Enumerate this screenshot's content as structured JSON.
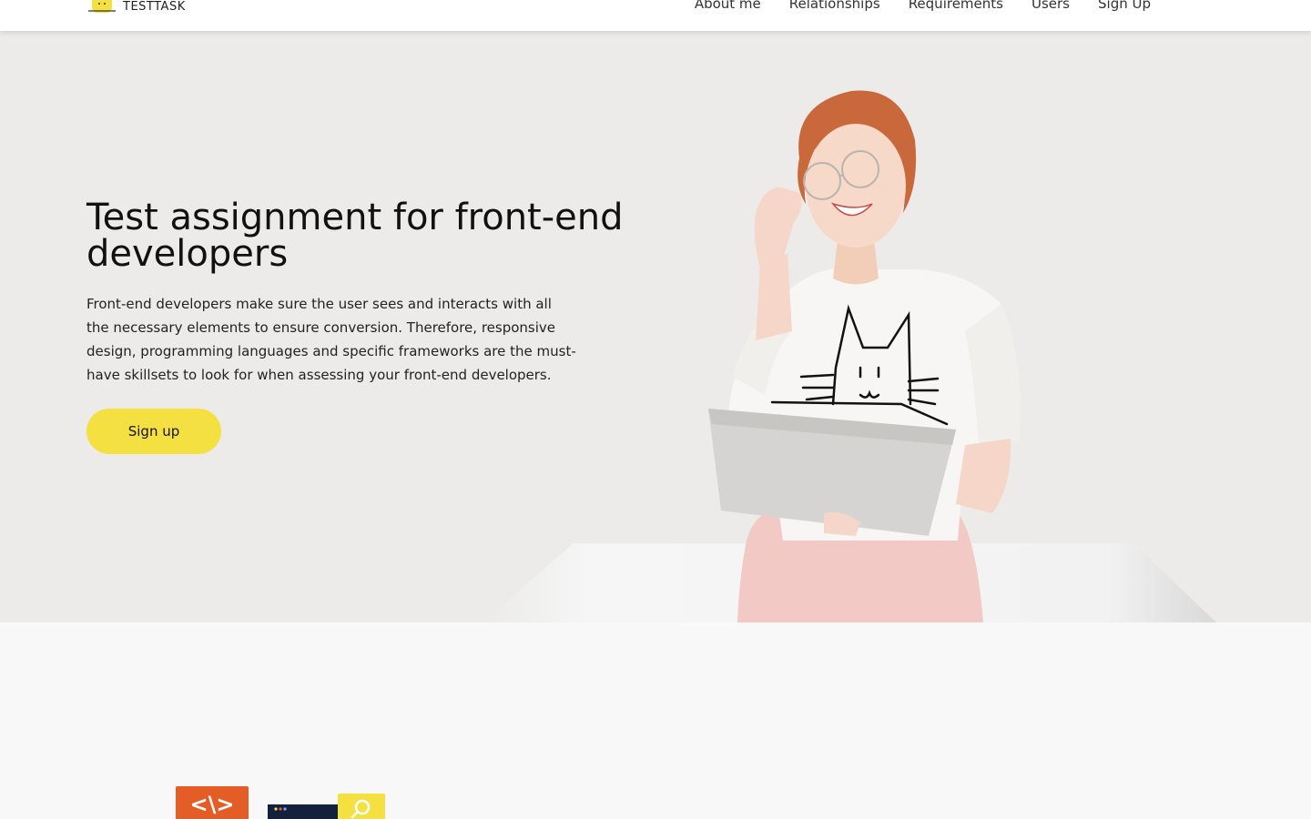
{
  "header": {
    "logo_text": "TESTTASK",
    "logo_icon": "cat-logo-icon",
    "nav": [
      {
        "label": "About me"
      },
      {
        "label": "Relationships"
      },
      {
        "label": "Requirements"
      },
      {
        "label": "Users"
      },
      {
        "label": "Sign Up"
      }
    ]
  },
  "hero": {
    "title": "Test assignment for front-end developers",
    "text": "Front-end developers make sure the user sees and interacts with all the necessary elements to ensure conversion. Therefore, responsive design, programming languages and specific frameworks are the must-have skillsets to look for when assessing your front-end developers.",
    "button_label": "Sign up",
    "image": "woman-with-laptop-illustration"
  },
  "section2": {
    "code_icon_label": "<\\>",
    "illustration": "code-and-search-illustration"
  },
  "colors": {
    "accent": "#f4e041",
    "hero_bg": "#ecebea",
    "code_icon_bg": "#e45d26"
  }
}
